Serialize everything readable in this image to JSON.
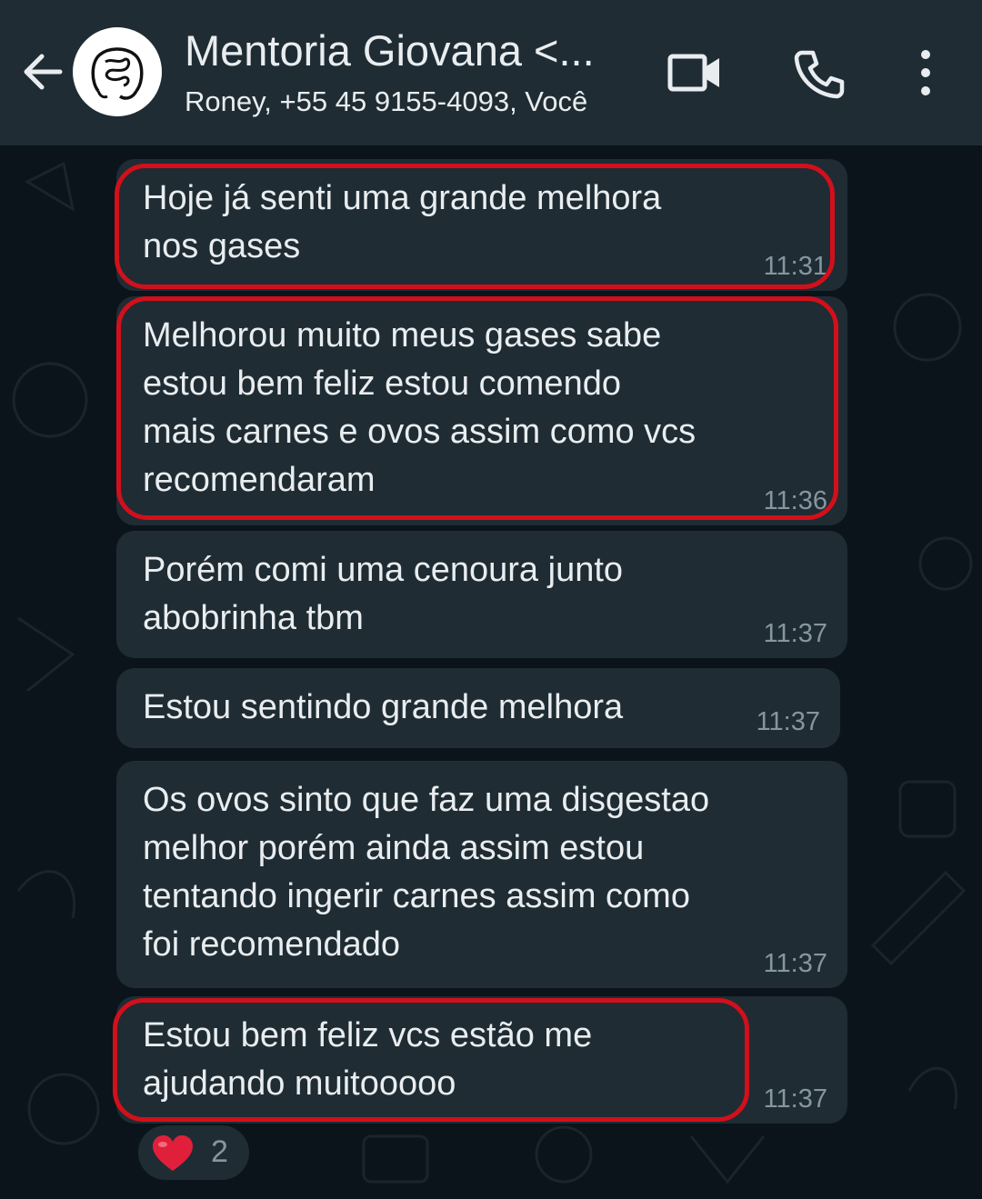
{
  "header": {
    "title": "Mentoria Giovana <...",
    "participants": "Roney, +55 45 9155-4093, Você",
    "icons": [
      "back-arrow-icon",
      "group-avatar-intestine-icon",
      "video-call-icon",
      "phone-call-icon",
      "more-options-icon"
    ]
  },
  "messages": [
    {
      "text": "Hoje já senti uma grande melhora\nnos gases",
      "time": "11:31",
      "highlighted": true
    },
    {
      "text": "Melhorou muito meus gases sabe\nestou bem feliz estou comendo\nmais carnes e ovos assim como vcs\nrecomendaram",
      "time": "11:36",
      "highlighted": true
    },
    {
      "text": "Porém comi uma cenoura junto\nabobrinha tbm",
      "time": "11:37",
      "highlighted": false
    },
    {
      "text": "Estou sentindo grande melhora",
      "time": "11:37",
      "highlighted": false
    },
    {
      "text": "Os ovos sinto que faz uma disgestao\nmelhor porém ainda assim estou\ntentando ingerir carnes assim como\nfoi recomendado",
      "time": "11:37",
      "highlighted": false
    },
    {
      "text": "Estou bem feliz vcs estão me\najudando muitooooo",
      "time": "11:37",
      "highlighted": true
    }
  ],
  "reaction": {
    "emoji": "heart-icon",
    "count": "2"
  },
  "colors": {
    "header_bg": "#1f2c34",
    "chat_bg": "#0b141a",
    "bubble_bg": "#1f2c34",
    "text": "#e9edef",
    "time": "#8696a0",
    "highlight": "#d1101b",
    "heart": "#e0203a"
  }
}
